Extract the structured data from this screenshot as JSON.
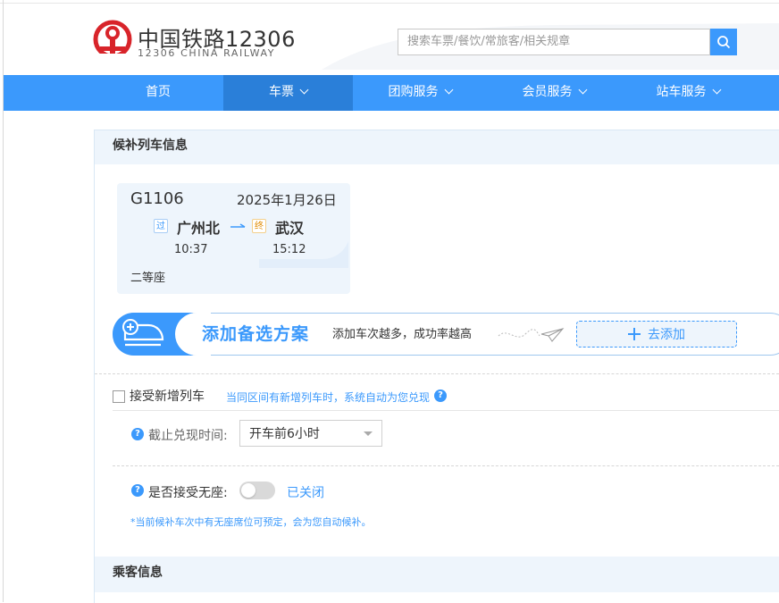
{
  "header": {
    "logo_cn": "中国铁路12306",
    "logo_en": "12306 CHINA RAILWAY",
    "search_placeholder": "搜索车票/餐饮/常旅客/相关规章"
  },
  "nav": {
    "items": [
      {
        "label": "首页",
        "has_dropdown": false,
        "active": false
      },
      {
        "label": "车票",
        "has_dropdown": true,
        "active": true
      },
      {
        "label": "团购服务",
        "has_dropdown": true,
        "active": false
      },
      {
        "label": "会员服务",
        "has_dropdown": true,
        "active": false
      },
      {
        "label": "站车服务",
        "has_dropdown": true,
        "active": false
      }
    ]
  },
  "waitlist": {
    "section_title": "候补列车信息",
    "train": {
      "code": "G1106",
      "date": "2025年1月26日",
      "from_tag": "过",
      "from_station": "广州北",
      "to_tag": "终",
      "to_station": "武汉",
      "depart_time": "10:37",
      "arrive_time": "15:12",
      "seat_class": "二等座"
    },
    "add_option": {
      "title": "添加备选方案",
      "subtitle": "添加车次越多，成功率越高",
      "button_label": "去添加"
    },
    "accept_new_trains": {
      "label": "接受新增列车",
      "hint": "当同区间有新增列车时，系统自动为您兑现",
      "checked": false
    },
    "deadline": {
      "label": "截止兑现时间:",
      "value": "开车前6小时"
    },
    "no_seat": {
      "label": "是否接受无座:",
      "state": "已关闭",
      "enabled": false,
      "note": "*当前候补车次中有无座席位可预定，会为您自动候补。"
    }
  },
  "passenger": {
    "section_title": "乘客信息"
  },
  "colors": {
    "brand_blue": "#3b99fc",
    "nav_active": "#2a7fd9",
    "logo_red": "#d8242a",
    "panel_bg": "#eef5fc"
  },
  "icons": {
    "search": "search-icon",
    "plus": "plus-icon",
    "question": "question-icon",
    "train_add": "train-add-icon"
  }
}
